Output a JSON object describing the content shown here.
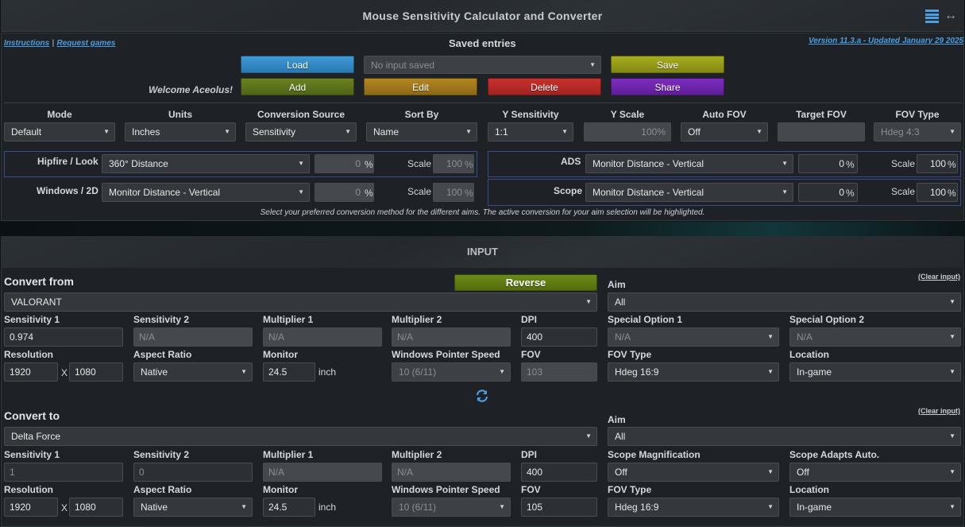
{
  "header": {
    "title": "Mouse Sensitivity Calculator and Converter"
  },
  "links": {
    "instructions": "Instructions",
    "separator": "|",
    "request": "Request games",
    "version": "Version 11.3.a - Updated January 29 2025"
  },
  "saved": {
    "heading": "Saved entries",
    "welcome": "Welcome Aceolus!",
    "dropdown": "No input saved",
    "load": "Load",
    "save": "Save",
    "add": "Add",
    "edit": "Edit",
    "delete": "Delete",
    "share": "Share"
  },
  "settings": {
    "labels": [
      "Mode",
      "Units",
      "Conversion Source",
      "Sort By",
      "Y Sensitivity",
      "Y Scale",
      "Auto FOV",
      "Target FOV",
      "FOV Type"
    ],
    "mode": "Default",
    "units": "Inches",
    "source": "Sensitivity",
    "sort": "Name",
    "ysens": "1:1",
    "yscale": "100%",
    "autofov": "Off",
    "targetfov": "",
    "fovtype": "Hdeg 4:3"
  },
  "aims": {
    "hipfire": {
      "label": "Hipfire / Look",
      "method": "360° Distance",
      "value": "0",
      "pct": "%",
      "scale_label": "Scale",
      "scale": "100",
      "scale_pct": "%"
    },
    "windows": {
      "label": "Windows / 2D",
      "method": "Monitor Distance - Vertical",
      "value": "0",
      "pct": "%",
      "scale_label": "Scale",
      "scale": "100",
      "scale_pct": "%"
    },
    "ads": {
      "label": "ADS",
      "method": "Monitor Distance - Vertical",
      "value": "0",
      "pct": "%",
      "scale_label": "Scale",
      "scale": "100",
      "scale_pct": "%"
    },
    "scope": {
      "label": "Scope",
      "method": "Monitor Distance - Vertical",
      "value": "0",
      "pct": "%",
      "scale_label": "Scale",
      "scale": "100",
      "scale_pct": "%"
    },
    "hint": "Select your preferred conversion method for the different aims. The active conversion for your aim selection will be highlighted."
  },
  "input": {
    "heading": "INPUT",
    "reverse": "Reverse",
    "clear": "(Clear input)"
  },
  "from": {
    "heading": "Convert from",
    "game": "VALORANT",
    "aim_label": "Aim",
    "aim": "All",
    "l_sens1": "Sensitivity 1",
    "sens1": "0.974",
    "l_sens2": "Sensitivity 2",
    "sens2": "N/A",
    "l_mult1": "Multiplier 1",
    "mult1": "N/A",
    "l_mult2": "Multiplier 2",
    "mult2": "N/A",
    "l_dpi": "DPI",
    "dpi": "400",
    "l_sp1": "Special Option 1",
    "sp1": "N/A",
    "l_sp2": "Special Option 2",
    "sp2": "N/A",
    "l_res": "Resolution",
    "res_w": "1920",
    "res_x": "X",
    "res_h": "1080",
    "l_aspect": "Aspect Ratio",
    "aspect": "Native",
    "l_monitor": "Monitor",
    "monitor": "24.5",
    "inch": "inch",
    "l_wps": "Windows Pointer Speed",
    "wps": "10 (6/11)",
    "l_fov": "FOV",
    "fov": "103",
    "l_fovtype": "FOV Type",
    "fovtype": "Hdeg 16:9",
    "l_loc": "Location",
    "loc": "In-game"
  },
  "to": {
    "heading": "Convert to",
    "game": "Delta Force",
    "aim_label": "Aim",
    "aim": "All",
    "l_sens1": "Sensitivity 1",
    "sens1": "1",
    "l_sens2": "Sensitivity 2",
    "sens2": "0",
    "l_mult1": "Multiplier 1",
    "mult1": "N/A",
    "l_mult2": "Multiplier 2",
    "mult2": "N/A",
    "l_dpi": "DPI",
    "dpi": "400",
    "l_sp1": "Scope Magnification",
    "sp1": "Off",
    "l_sp2": "Scope Adapts Auto.",
    "sp2": "Off",
    "l_res": "Resolution",
    "res_w": "1920",
    "res_x": "X",
    "res_h": "1080",
    "l_aspect": "Aspect Ratio",
    "aspect": "Native",
    "l_monitor": "Monitor",
    "monitor": "24.5",
    "inch": "inch",
    "l_wps": "Windows Pointer Speed",
    "wps": "10 (6/11)",
    "l_fov": "FOV",
    "fov": "105",
    "l_fovtype": "FOV Type",
    "fovtype": "Hdeg 16:9",
    "l_loc": "Location",
    "loc": "In-game"
  },
  "icons": {
    "menu": "hamburger-icon",
    "expand": "horizontal-arrows-icon",
    "swap": "refresh-icon",
    "caret": "caret-down-icon"
  }
}
